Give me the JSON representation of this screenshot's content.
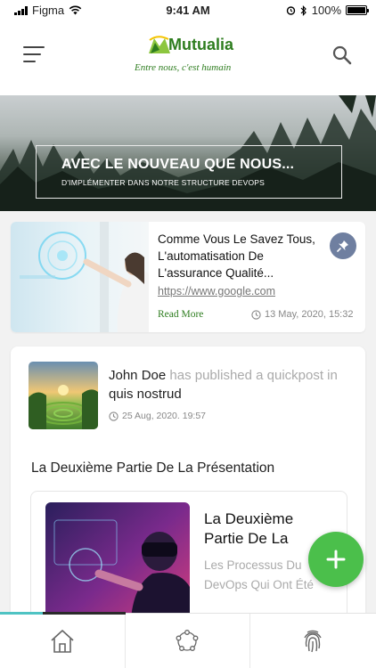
{
  "status_bar": {
    "carrier": "Figma",
    "time": "9:41 AM",
    "battery": "100%"
  },
  "header": {
    "logo": {
      "name": "Mutualia",
      "tagline": "Entre nous, c'est humain"
    },
    "menu_icon": "hamburger-icon",
    "search_icon": "search-icon"
  },
  "hero": {
    "title": "AVEC LE NOUVEAU QUE NOUS...",
    "subtitle": "D'IMPLÉMENTER DANS NOTRE STRUCTURE DEVOPS"
  },
  "article": {
    "title": "Comme Vous Le Savez Tous, L'automatisation De L'assurance Qualité...",
    "link": "https://www.google.com",
    "read_more": "Read More",
    "date": "13 May, 2020, 15:32",
    "pin_icon": "pin-icon"
  },
  "quickpost": {
    "author": "John Doe",
    "action_has": "has",
    "action_rest": "published a quickpost in",
    "group": "quis nostrud",
    "date": "25 Aug, 2020. 19:57",
    "heading": "La Deuxième Partie De La Présentation",
    "card": {
      "title": "La Deuxième Partie De La",
      "description": "Les Processus Du DevOps Qui Ont Été"
    }
  },
  "fab": {
    "icon": "plus-icon"
  },
  "bottom_nav": {
    "items": [
      {
        "icon": "home-icon"
      },
      {
        "icon": "network-icon"
      },
      {
        "icon": "fingerprint-icon"
      }
    ]
  },
  "colors": {
    "brand_green": "#2e7d1f",
    "fab_green": "#4bbf4b",
    "pin_blue": "#6f7fa0",
    "nav_active_teal": "#4fc3c3"
  }
}
